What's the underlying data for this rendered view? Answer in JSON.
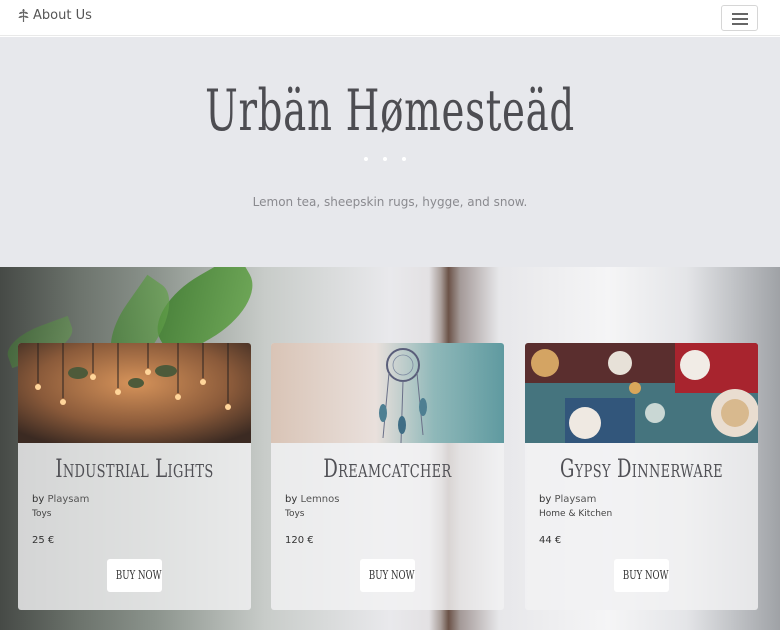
{
  "nav": {
    "brand_label": "About Us",
    "brand_icon": "leaf-icon",
    "menu_icon": "hamburger-menu-icon"
  },
  "hero": {
    "title": "Urbän Hømesteäd",
    "subtitle": "Lemon tea, sheepskin rugs, hygge, and snow."
  },
  "colors": {
    "hero_background": "#e7e8ec",
    "navbar_background": "#ffffff",
    "card_background": "#f2f2f3"
  },
  "products": [
    {
      "title": "Industrial Lights",
      "by_prefix": "by",
      "maker": "Playsam",
      "category": "Toys",
      "price": "25 €",
      "button": "BUY NOW",
      "image": "industrial-lights-photo"
    },
    {
      "title": "Dreamcatcher",
      "by_prefix": "by",
      "maker": "Lemnos",
      "category": "Toys",
      "price": "120 €",
      "button": "BUY NOW",
      "image": "dreamcatcher-photo"
    },
    {
      "title": "Gypsy Dinnerware",
      "by_prefix": "by",
      "maker": "Playsam",
      "category": "Home & Kitchen",
      "price": "44 €",
      "button": "BUY NOW",
      "image": "gypsy-dinnerware-photo"
    }
  ]
}
